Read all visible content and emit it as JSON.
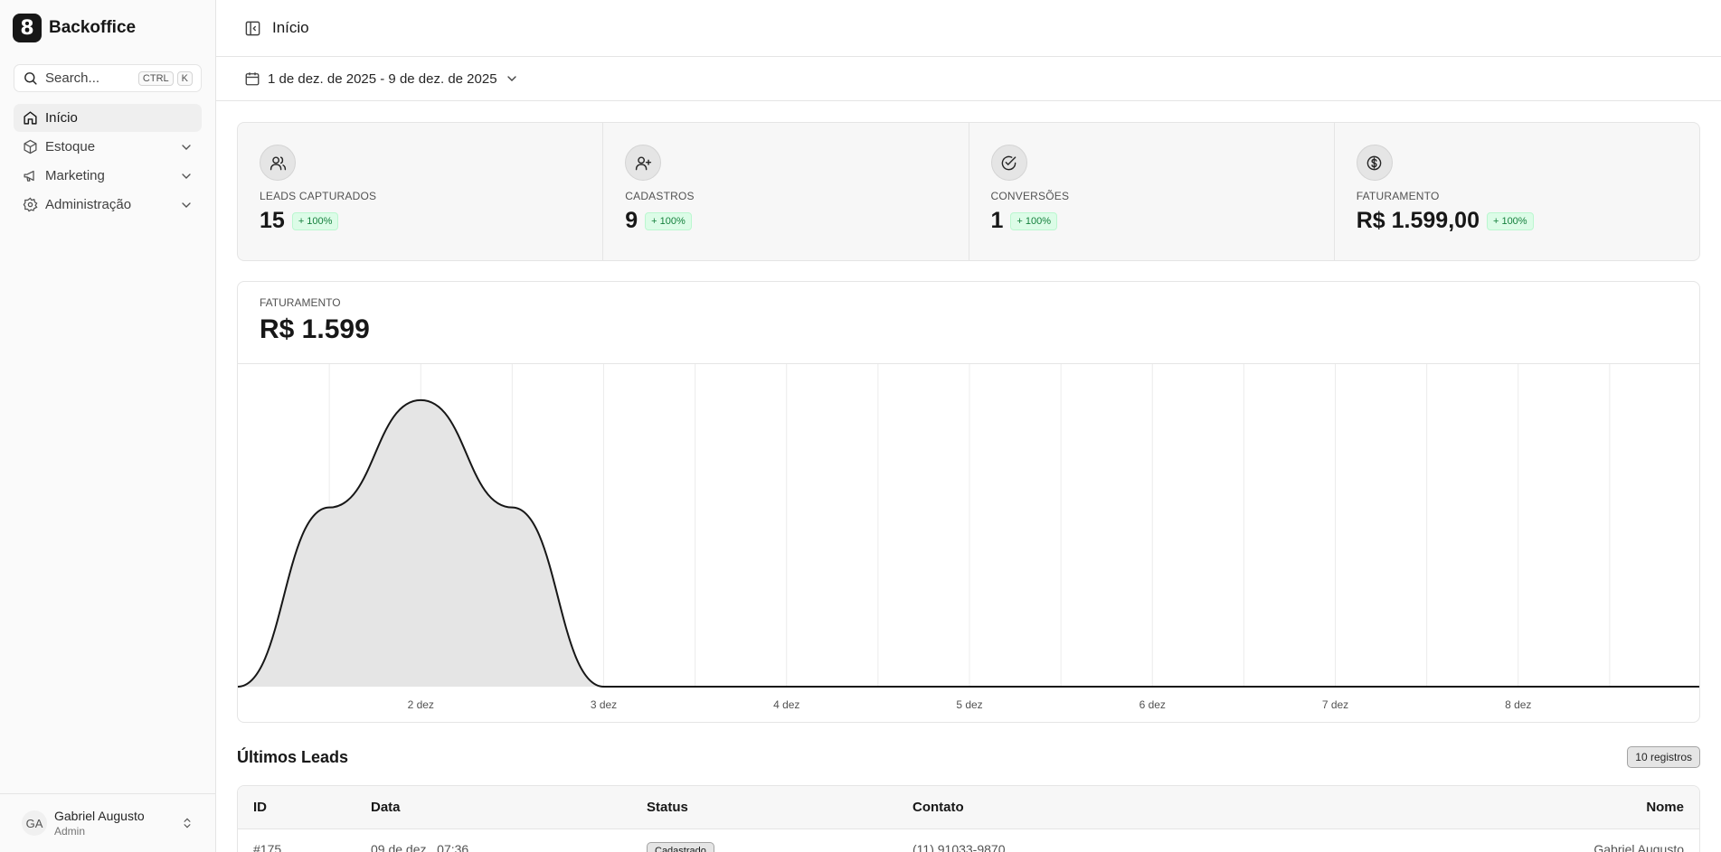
{
  "app": {
    "name": "Backoffice",
    "logo_glyph": "8"
  },
  "search": {
    "placeholder": "Search...",
    "kbd1": "CTRL",
    "kbd2": "K"
  },
  "nav": {
    "items": [
      {
        "label": "Início",
        "icon": "home-icon",
        "active": true
      },
      {
        "label": "Estoque",
        "icon": "box-icon",
        "active": false
      },
      {
        "label": "Marketing",
        "icon": "megaphone-icon",
        "active": false
      },
      {
        "label": "Administração",
        "icon": "gear-icon",
        "active": false
      }
    ]
  },
  "user": {
    "initials": "GA",
    "name": "Gabriel Augusto",
    "role": "Admin"
  },
  "topbar": {
    "title": "Início"
  },
  "filter": {
    "date_range": "1 de dez. de 2025 - 9 de dez. de 2025"
  },
  "stats": [
    {
      "label": "LEADS CAPTURADOS",
      "value": "15",
      "change": "+ 100%",
      "icon": "users-icon"
    },
    {
      "label": "CADASTROS",
      "value": "9",
      "change": "+ 100%",
      "icon": "user-plus-icon"
    },
    {
      "label": "CONVERSÕES",
      "value": "1",
      "change": "+ 100%",
      "icon": "check-circle-icon"
    },
    {
      "label": "FATURAMENTO",
      "value": "R$ 1.599,00",
      "change": "+ 100%",
      "icon": "dollar-circle-icon"
    }
  ],
  "revenue": {
    "label": "FATURAMENTO",
    "value": "R$ 1.599"
  },
  "chart_data": {
    "type": "area",
    "x": [
      "1 dez",
      "1.5 dez",
      "2 dez",
      "2.5 dez",
      "3 dez",
      "3.5 dez",
      "4 dez",
      "4.5 dez",
      "5 dez",
      "5.5 dez",
      "6 dez",
      "6.5 dez",
      "7 dez",
      "7.5 dez",
      "8 dez",
      "8.5 dez",
      "9 dez"
    ],
    "tick_labels": [
      "2 dez",
      "3 dez",
      "4 dez",
      "5 dez",
      "6 dez",
      "7 dez",
      "8 dez"
    ],
    "tick_positions": [
      2,
      4,
      6,
      8,
      10,
      12,
      14
    ],
    "values": [
      0,
      1000,
      1599,
      1000,
      0,
      0,
      0,
      0,
      0,
      0,
      0,
      0,
      0,
      0,
      0,
      0,
      0
    ],
    "ylim": [
      0,
      1800
    ],
    "grid": true,
    "line_color": "#171717",
    "fill_color": "#e5e5e5"
  },
  "leads": {
    "title": "Últimos Leads",
    "count": "10 registros",
    "columns": [
      "ID",
      "Data",
      "Status",
      "Contato",
      "Nome"
    ],
    "rows": [
      {
        "id": "#175",
        "date": "09 de dez., 07:36",
        "status": "Cadastrado",
        "contact": "(11) 91033-9870",
        "name": "Gabriel Augusto"
      }
    ]
  }
}
